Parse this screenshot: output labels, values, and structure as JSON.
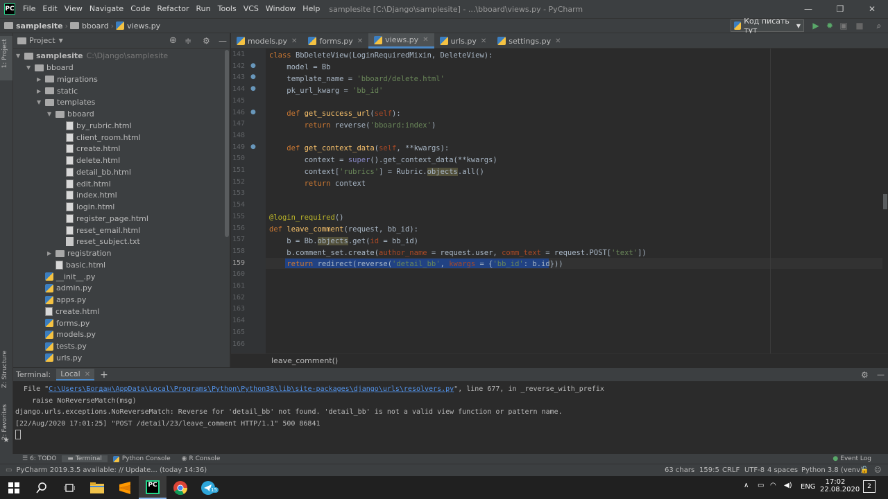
{
  "menu": {
    "items": [
      "File",
      "Edit",
      "View",
      "Navigate",
      "Code",
      "Refactor",
      "Run",
      "Tools",
      "VCS",
      "Window",
      "Help"
    ],
    "window_title": "samplesite [C:\\Django\\samplesite] - ...\\bboard\\views.py - PyCharm"
  },
  "nav": {
    "crumbs": [
      "samplesite",
      "bboard",
      "views.py"
    ],
    "run_config": "Код писать тут"
  },
  "project_panel": {
    "title": "Project",
    "root": {
      "name": "samplesite",
      "path": "C:\\Django\\samplesite"
    },
    "rows": [
      {
        "label": "bboard",
        "type": "folder",
        "depth": 1,
        "open": true
      },
      {
        "label": "migrations",
        "type": "folder",
        "depth": 2,
        "open": false
      },
      {
        "label": "static",
        "type": "folder",
        "depth": 2,
        "open": false
      },
      {
        "label": "templates",
        "type": "folder",
        "depth": 2,
        "open": true
      },
      {
        "label": "bboard",
        "type": "folder",
        "depth": 3,
        "open": true
      },
      {
        "label": "by_rubric.html",
        "type": "html",
        "depth": 4
      },
      {
        "label": "client_room.html",
        "type": "html",
        "depth": 4
      },
      {
        "label": "create.html",
        "type": "html",
        "depth": 4
      },
      {
        "label": "delete.html",
        "type": "html",
        "depth": 4
      },
      {
        "label": "detail_bb.html",
        "type": "html",
        "depth": 4
      },
      {
        "label": "edit.html",
        "type": "html",
        "depth": 4
      },
      {
        "label": "index.html",
        "type": "html",
        "depth": 4
      },
      {
        "label": "login.html",
        "type": "html",
        "depth": 4
      },
      {
        "label": "register_page.html",
        "type": "html",
        "depth": 4
      },
      {
        "label": "reset_email.html",
        "type": "html",
        "depth": 4
      },
      {
        "label": "reset_subject.txt",
        "type": "txt",
        "depth": 4
      },
      {
        "label": "registration",
        "type": "folder",
        "depth": 3,
        "open": false
      },
      {
        "label": "basic.html",
        "type": "html",
        "depth": 3
      },
      {
        "label": "__init__.py",
        "type": "py",
        "depth": 2
      },
      {
        "label": "admin.py",
        "type": "py",
        "depth": 2
      },
      {
        "label": "apps.py",
        "type": "py",
        "depth": 2
      },
      {
        "label": "create.html",
        "type": "html",
        "depth": 2
      },
      {
        "label": "forms.py",
        "type": "py",
        "depth": 2
      },
      {
        "label": "models.py",
        "type": "py",
        "depth": 2
      },
      {
        "label": "tests.py",
        "type": "py",
        "depth": 2
      },
      {
        "label": "urls.py",
        "type": "py",
        "depth": 2
      }
    ]
  },
  "editor": {
    "tabs": [
      "models.py",
      "forms.py",
      "views.py",
      "urls.py",
      "settings.py"
    ],
    "active_tab": "views.py",
    "line_numbers": [
      "141",
      "142",
      "143",
      "144",
      "145",
      "146",
      "147",
      "148",
      "149",
      "150",
      "151",
      "152",
      "153",
      "154",
      "155",
      "156",
      "157",
      "158",
      "159",
      "160",
      "161",
      "162",
      "163",
      "164",
      "165",
      "166"
    ],
    "breadcrumb": "leave_comment()"
  },
  "terminal": {
    "label": "Terminal:",
    "tab": "Local",
    "line1_prefix": "  File \"",
    "line1_link": "C:\\Users\\Богдан\\AppData\\Local\\Programs\\Python\\Python38\\lib\\site-packages\\django\\urls\\resolvers.py",
    "line1_suffix": "\", line 677, in _reverse_with_prefix",
    "line2": "    raise NoReverseMatch(msg)",
    "line3": "django.urls.exceptions.NoReverseMatch: Reverse for 'detail_bb' not found. 'detail_bb' is not a valid view function or pattern name.",
    "line4": "[22/Aug/2020 17:01:25] \"POST /detail/23/leave_comment HTTP/1.1\" 500 86841"
  },
  "tool_windows": [
    "6: TODO",
    "Terminal",
    "Python Console",
    "R Console"
  ],
  "event_log": "Event Log",
  "left_strip": {
    "project": "1: Project",
    "structure": "Z: Structure",
    "favorites": "2: Favorites"
  },
  "status": {
    "message": "PyCharm 2019.3.5 available: // Update... (today 14:36)",
    "chars": "63 chars",
    "position": "159:5",
    "line_sep": "CRLF",
    "encoding": "UTF-8",
    "indent": "4 spaces",
    "interpreter": "Python 3.8 (venv)"
  },
  "taskbar": {
    "time": "17:02",
    "date": "22.08.2020",
    "lang": "ENG",
    "notif": "2",
    "badge": "15"
  }
}
